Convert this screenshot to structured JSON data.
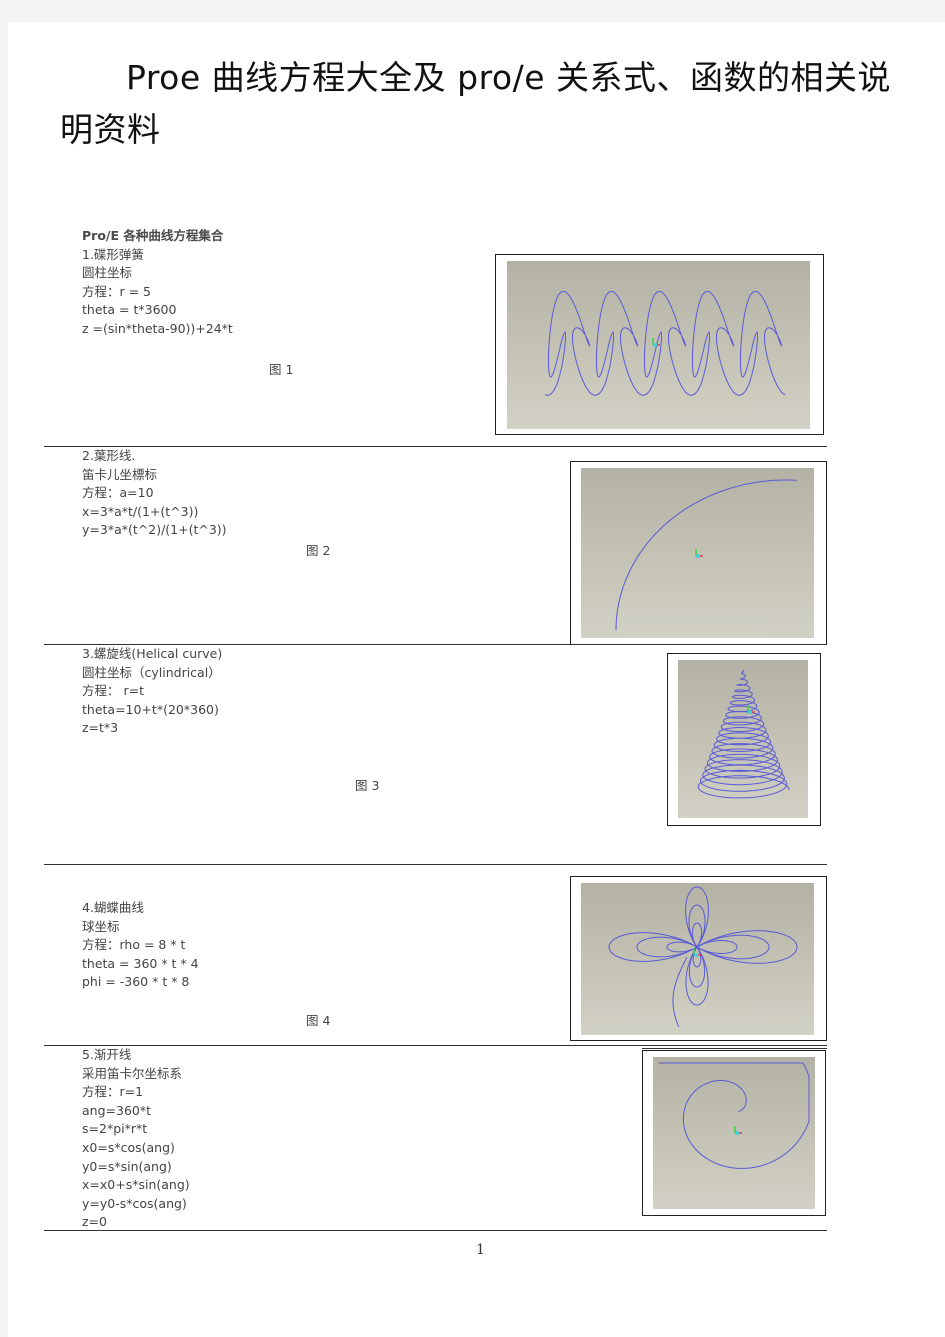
{
  "document": {
    "title": "Proe 曲线方程大全及 pro/e 关系式、函数的相关说明资料",
    "title_line1": "Proe 曲线方程大全及 pro/e 关系式、函数的相关说",
    "title_line2": "明资料",
    "section_heading": "Pro/E 各种曲线方程集合",
    "page_number": "1"
  },
  "curves": [
    {
      "lines": [
        "1.碟形弹簧",
        "圆柱坐标",
        "方程：r = 5",
        "theta = t*3600",
        "z =(sin*theta-90))+24*t"
      ],
      "caption": "图 1",
      "figure": "disc-spring-curve"
    },
    {
      "lines": [
        "2.葉形线.",
        "笛卡儿坐標标",
        "方程：a=10",
        "x=3*a*t/(1+(t^3))",
        "y=3*a*(t^2)/(1+(t^3))"
      ],
      "caption": "图 2",
      "figure": "folium-curve"
    },
    {
      "lines": [
        "3.螺旋线(Helical curve)",
        "圆柱坐标（cylindrical）",
        "方程： r=t",
        "theta=10+t*(20*360)",
        "z=t*3"
      ],
      "caption": "图 3",
      "figure": "conical-helix-curve"
    },
    {
      "lines": [
        "4.蝴蝶曲线",
        "球坐标",
        "方程：rho = 8 * t",
        "theta = 360 * t * 4",
        "phi = -360 * t * 8"
      ],
      "caption": "图 4",
      "figure": "butterfly-curve"
    },
    {
      "lines": [
        "5.渐开线",
        "采用笛卡尔坐标系",
        "方程：r=1",
        "ang=360*t",
        "s=2*pi*r*t",
        "x0=s*cos(ang)",
        "y0=s*sin(ang)",
        "x=x0+s*sin(ang)",
        "y=y0-s*cos(ang)",
        "z=0"
      ],
      "caption": "",
      "figure": "involute-curve"
    }
  ],
  "colors": {
    "curve": "#5a5ad6",
    "viewport_bg": "#c2c1b4",
    "axis_x": "#e0405a",
    "axis_y": "#40d040",
    "axis_z": "#40d0d8"
  }
}
